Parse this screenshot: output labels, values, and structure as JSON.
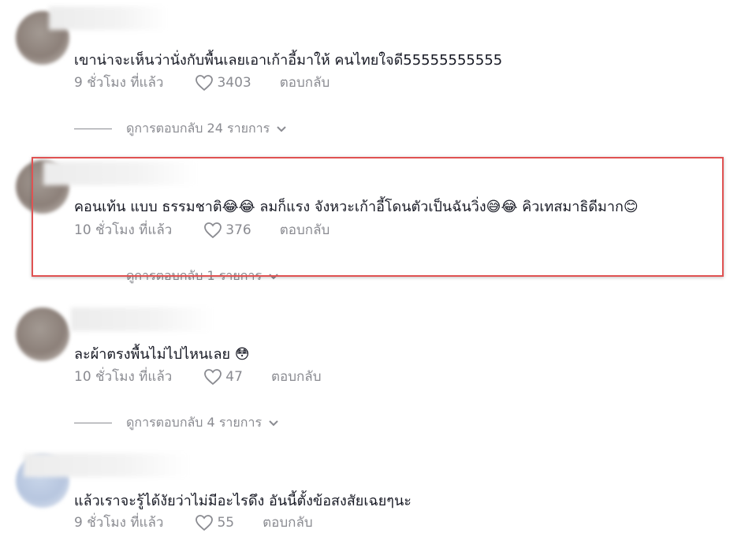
{
  "comments": [
    {
      "text": "เขาน่าจะเห็นว่านั่งกับพื้นเลยเอาเก้าอี้มาให้ คนไทยใจดี55555555555",
      "time": "9 ชั่วโมง ที่แล้ว",
      "likes": "3403",
      "reply_label": "ตอบกลับ",
      "view_replies": "ดูการตอบกลับ 24 รายการ"
    },
    {
      "text": "คอนเท้น แบบ ธรรมชาติ😂😂 ลมก็แรง จังหวะเก้าอี้โดนตัวเป็นฉันวิ่ง😅😂 คิวเทสมาธิดีมาก😊",
      "time": "10 ชั่วโมง ที่แล้ว",
      "likes": "376",
      "reply_label": "ตอบกลับ",
      "view_replies": "ดูการตอบกลับ 1 รายการ"
    },
    {
      "text": "ละผ้าตรงพื้นไม่ไปไหนเลย 😳",
      "time": "10 ชั่วโมง ที่แล้ว",
      "likes": "47",
      "reply_label": "ตอบกลับ",
      "view_replies": "ดูการตอบกลับ 4 รายการ"
    },
    {
      "text": "แล้วเราจะรู้ได้งัยว่าไม่มีอะไรดึง อันนี้ตั้งข้อสงสัยเฉยๆนะ",
      "time": "9 ชั่วโมง ที่แล้ว",
      "likes": "55",
      "reply_label": "ตอบกลับ"
    }
  ],
  "colors": {
    "text": "#161823",
    "muted": "#8a8b91",
    "highlight_border": "#e05252"
  },
  "icons": {
    "like": "heart-outline-icon",
    "expand": "chevron-down-icon"
  }
}
